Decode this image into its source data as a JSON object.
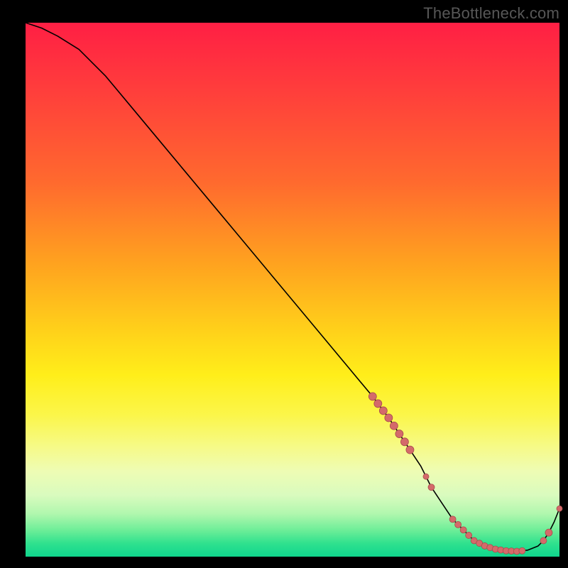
{
  "watermark": "TheBottleneck.com",
  "colors": {
    "curve": "#000000",
    "marker_fill": "#d46a6a",
    "marker_stroke": "#a84c4c"
  },
  "chart_data": {
    "type": "line",
    "title": "",
    "xlabel": "",
    "ylabel": "",
    "xlim": [
      0,
      100
    ],
    "ylim": [
      0,
      100
    ],
    "x": [
      0,
      3,
      6,
      10,
      15,
      20,
      25,
      30,
      35,
      40,
      45,
      50,
      55,
      60,
      65,
      68,
      70,
      72,
      74,
      75,
      76,
      78,
      80,
      82,
      84,
      86,
      88,
      90,
      92,
      94,
      96,
      97,
      98,
      99,
      100
    ],
    "values": [
      100,
      99,
      97.5,
      95,
      90,
      84,
      78,
      72,
      66,
      60,
      54,
      48,
      42,
      36,
      30,
      26,
      23,
      20,
      17,
      15,
      13,
      10,
      7,
      5,
      3,
      2,
      1.4,
      1.1,
      1.0,
      1.2,
      2.0,
      3.0,
      4.5,
      6.5,
      9
    ],
    "markers_x": [
      65,
      66,
      67,
      68,
      69,
      70,
      71,
      72,
      75,
      76,
      80,
      81,
      82,
      83,
      84,
      85,
      86,
      87,
      88,
      89,
      90,
      91,
      92,
      93,
      97,
      98,
      100
    ],
    "marker_radii": {
      "65": 5.5,
      "66": 5.5,
      "67": 5.5,
      "68": 5.5,
      "69": 5.5,
      "70": 5.5,
      "71": 5.5,
      "72": 5.5,
      "75": 4.0,
      "76": 4.5,
      "80": 4.5,
      "81": 4.5,
      "82": 4.5,
      "83": 4.5,
      "84": 4.5,
      "85": 4.5,
      "86": 4.5,
      "87": 4.5,
      "88": 4.5,
      "89": 4.5,
      "90": 4.5,
      "91": 4.5,
      "92": 4.5,
      "93": 4.5,
      "97": 4.5,
      "98": 5.0,
      "100": 4.0
    }
  }
}
